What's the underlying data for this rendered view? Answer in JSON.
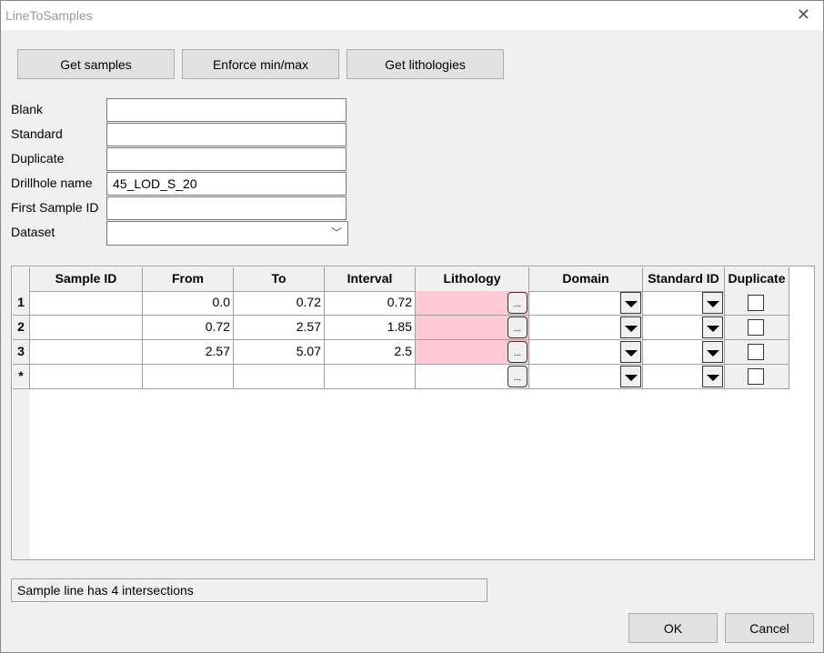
{
  "window": {
    "title": "LineToSamples",
    "close_icon": "close-icon"
  },
  "toolbar": {
    "get_samples": "Get samples",
    "enforce": "Enforce min/max",
    "get_lithologies": "Get lithologies"
  },
  "form": {
    "blank": {
      "label": "Blank",
      "value": ""
    },
    "standard": {
      "label": "Standard",
      "value": ""
    },
    "duplicate": {
      "label": "Duplicate",
      "value": ""
    },
    "drillhole": {
      "label": "Drillhole name",
      "value": "45_LOD_S_20"
    },
    "first_id": {
      "label": "First Sample ID",
      "value": ""
    },
    "dataset": {
      "label": "Dataset",
      "value": ""
    }
  },
  "grid": {
    "columns": [
      "Sample ID",
      "From",
      "To",
      "Interval",
      "Lithology",
      "Domain",
      "Standard ID",
      "Duplicate"
    ],
    "rows": [
      {
        "header": "1",
        "sample_id": "",
        "from": "0.0",
        "to": "0.72",
        "interval": "0.72"
      },
      {
        "header": "2",
        "sample_id": "",
        "from": "0.72",
        "to": "2.57",
        "interval": "1.85"
      },
      {
        "header": "3",
        "sample_id": "",
        "from": "2.57",
        "to": "5.07",
        "interval": "2.5"
      },
      {
        "header": "*",
        "sample_id": "",
        "from": "",
        "to": "",
        "interval": ""
      }
    ],
    "ellipsis": "...",
    "lithology_missing_color": "#ffcad4"
  },
  "status": "Sample line has 4 intersections",
  "footer": {
    "ok": "OK",
    "cancel": "Cancel"
  }
}
